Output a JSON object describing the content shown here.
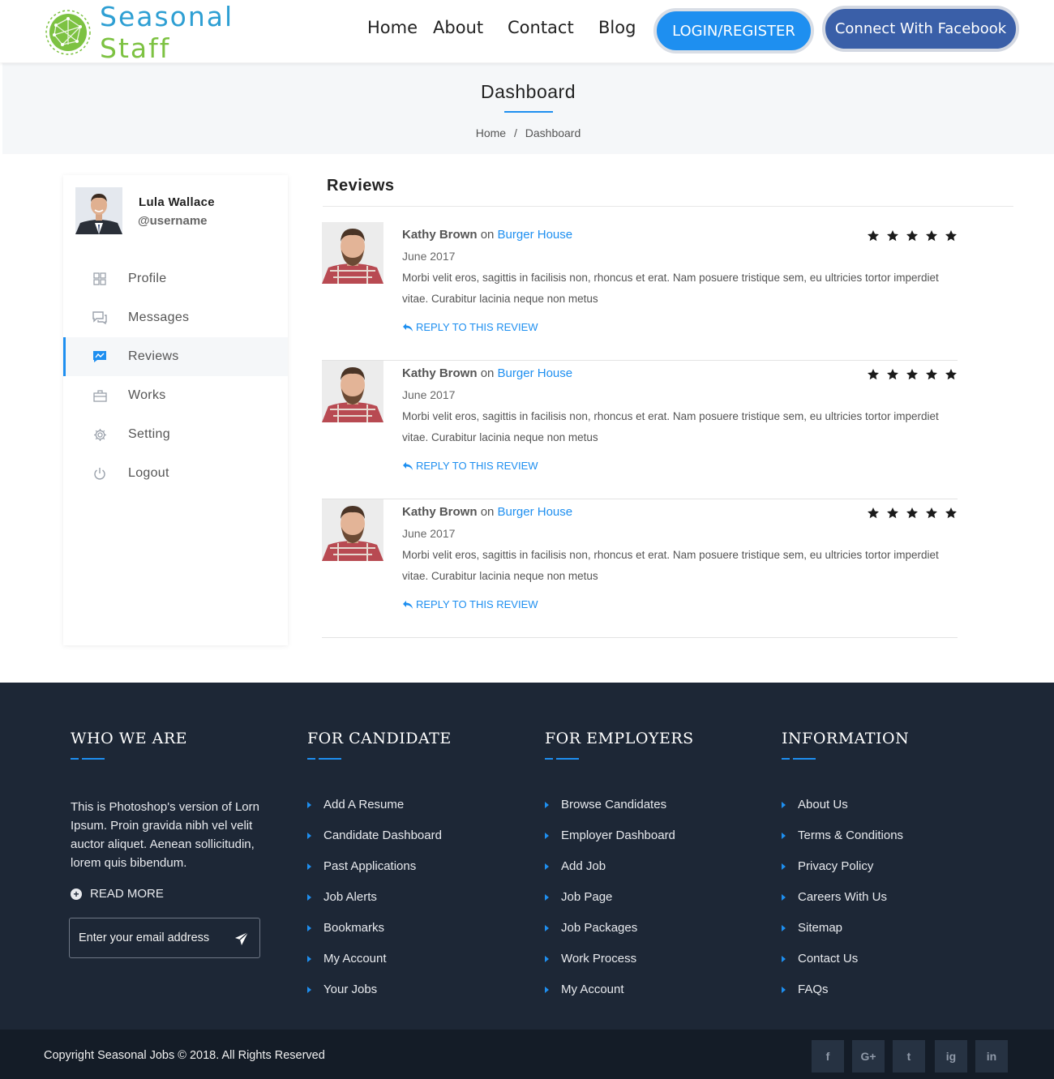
{
  "brand": {
    "name_part1": "Seasonal ",
    "name_part2": "Staff",
    "primary_color": "#1e8ff0",
    "accent_color": "#7dc242"
  },
  "nav": {
    "home": "Home",
    "about": "About",
    "contact": "Contact",
    "blog": "Blog",
    "login": "LOGIN/REGISTER",
    "facebook": "Connect With Facebook"
  },
  "page_header": {
    "title": "Dashboard",
    "breadcrumb": {
      "home": "Home",
      "separator": "/",
      "current": "Dashboard"
    }
  },
  "profile": {
    "name": "Lula Wallace",
    "username": "@username"
  },
  "sidebar": {
    "items": [
      {
        "label": "Profile",
        "icon": "profile-grid-icon"
      },
      {
        "label": "Messages",
        "icon": "messages-icon"
      },
      {
        "label": "Reviews",
        "icon": "reviews-icon",
        "active": true
      },
      {
        "label": "Works",
        "icon": "briefcase-icon"
      },
      {
        "label": "Setting",
        "icon": "gear-icon"
      },
      {
        "label": "Logout",
        "icon": "power-icon"
      }
    ]
  },
  "reviews": {
    "heading": "Reviews",
    "items": [
      {
        "author": "Kathy Brown",
        "on": "on",
        "place": "Burger House",
        "date": "June 2017",
        "text": "Morbi velit eros, sagittis in facilisis non, rhoncus et erat. Nam posuere tristique sem, eu ultricies tortor imperdiet vitae. Curabitur lacinia neque non metus",
        "reply": "REPLY TO THIS REVIEW",
        "rating": 5
      },
      {
        "author": "Kathy Brown",
        "on": "on",
        "place": "Burger House",
        "date": "June 2017",
        "text": "Morbi velit eros, sagittis in facilisis non, rhoncus et erat. Nam posuere tristique sem, eu ultricies tortor imperdiet vitae. Curabitur lacinia neque non metus",
        "reply": "REPLY TO THIS REVIEW",
        "rating": 5
      },
      {
        "author": "Kathy Brown",
        "on": "on",
        "place": "Burger House",
        "date": "June 2017",
        "text": "Morbi velit eros, sagittis in facilisis non, rhoncus et erat. Nam posuere tristique sem, eu ultricies tortor imperdiet vitae. Curabitur lacinia neque non metus",
        "reply": "REPLY TO THIS REVIEW",
        "rating": 5
      }
    ]
  },
  "footer": {
    "who_we_are": {
      "title": "WHO WE ARE",
      "text": "This is Photoshop's version of Lorn Ipsum. Proin gravida nibh vel velit auctor aliquet. Aenean sollicitudin, lorem quis bibendum.",
      "read_more": "READ MORE",
      "email_placeholder": "Enter your email address"
    },
    "for_candidate": {
      "title": "FOR CANDIDATE",
      "links": [
        "Add A Resume",
        "Candidate Dashboard",
        "Past Applications",
        "Job Alerts",
        "Bookmarks",
        "My Account",
        "Your Jobs"
      ]
    },
    "for_employers": {
      "title": "FOR EMPLOYERS",
      "links": [
        "Browse Candidates",
        "Employer Dashboard",
        "Add Job",
        "Job Page",
        "Job Packages",
        "Work Process",
        "My Account"
      ]
    },
    "information": {
      "title": "INFORMATION",
      "links": [
        "About Us",
        "Terms & Conditions",
        "Privacy Policy",
        "Careers With Us",
        "Sitemap",
        "Contact Us",
        "FAQs"
      ]
    },
    "copyright": "Copyright Seasonal Jobs © 2018. All Rights Reserved",
    "social": [
      {
        "label": "f",
        "icon": "facebook-icon"
      },
      {
        "label": "G+",
        "icon": "google-plus-icon"
      },
      {
        "label": "t",
        "icon": "twitter-icon"
      },
      {
        "label": "ig",
        "icon": "instagram-icon"
      },
      {
        "label": "in",
        "icon": "linkedin-icon"
      }
    ]
  }
}
